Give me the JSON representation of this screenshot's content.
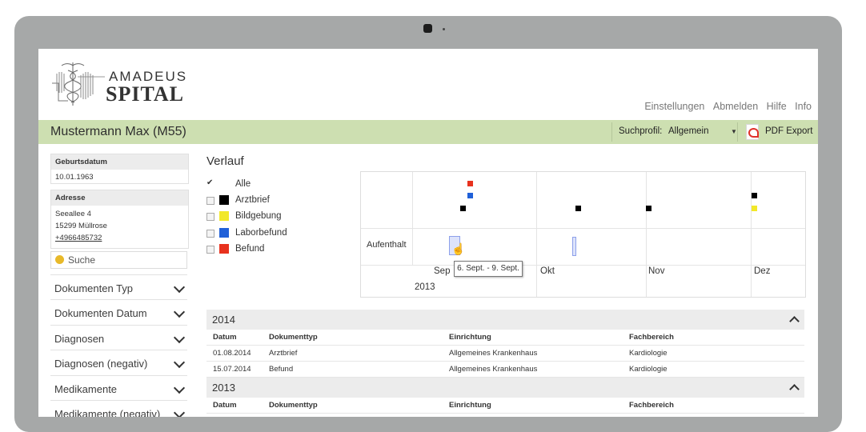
{
  "brand": {
    "line1": "AMADEUS",
    "line2": "SPITAL"
  },
  "topnav": [
    "Einstellungen",
    "Abmelden",
    "Hilfe",
    "Info"
  ],
  "patient": {
    "name": "Mustermann Max (M55)"
  },
  "toolbar": {
    "suchprofil_label": "Suchprofil:",
    "suchprofil_value": "Allgemein",
    "pdf_label": "PDF Export"
  },
  "sidebar": {
    "geburtsdatum_label": "Geburtsdatum",
    "geburtsdatum_value": "10.01.1963",
    "adresse_label": "Adresse",
    "adresse_lines": [
      "Seeallee 4",
      "15299 Müllrose",
      "+4966485732"
    ],
    "search_placeholder": "Suche",
    "filters": [
      "Dokumenten Typ",
      "Dokumenten Datum",
      "Diagnosen",
      "Diagnosen (negativ)",
      "Medikamente",
      "Medikamente (negativ)"
    ]
  },
  "verlauf": {
    "title": "Verlauf",
    "legend": [
      {
        "label": "Alle",
        "color": "",
        "checked": true
      },
      {
        "label": "Arztbrief",
        "color": "#000000",
        "checked": false
      },
      {
        "label": "Bildgebung",
        "color": "#f2e829",
        "checked": false
      },
      {
        "label": "Laborbefund",
        "color": "#2060d8",
        "checked": false
      },
      {
        "label": "Befund",
        "color": "#e8321e",
        "checked": false
      }
    ],
    "row_label": "Aufenthalt",
    "months": [
      "Sep",
      "Okt",
      "Nov",
      "Dez"
    ],
    "year": "2013",
    "tooltip": "6. Sept. - 9. Sept."
  },
  "table": {
    "columns": [
      "Datum",
      "Dokumenttyp",
      "Einrichtung",
      "Fachbereich"
    ],
    "groups": [
      {
        "year": "2014",
        "rows": [
          [
            "01.08.2014",
            "Arztbrief",
            "Allgemeines Krankenhaus",
            "Kardiologie"
          ],
          [
            "15.07.2014",
            "Befund",
            "Allgemeines Krankenhaus",
            "Kardiologie"
          ]
        ]
      },
      {
        "year": "2013",
        "rows": []
      }
    ]
  }
}
